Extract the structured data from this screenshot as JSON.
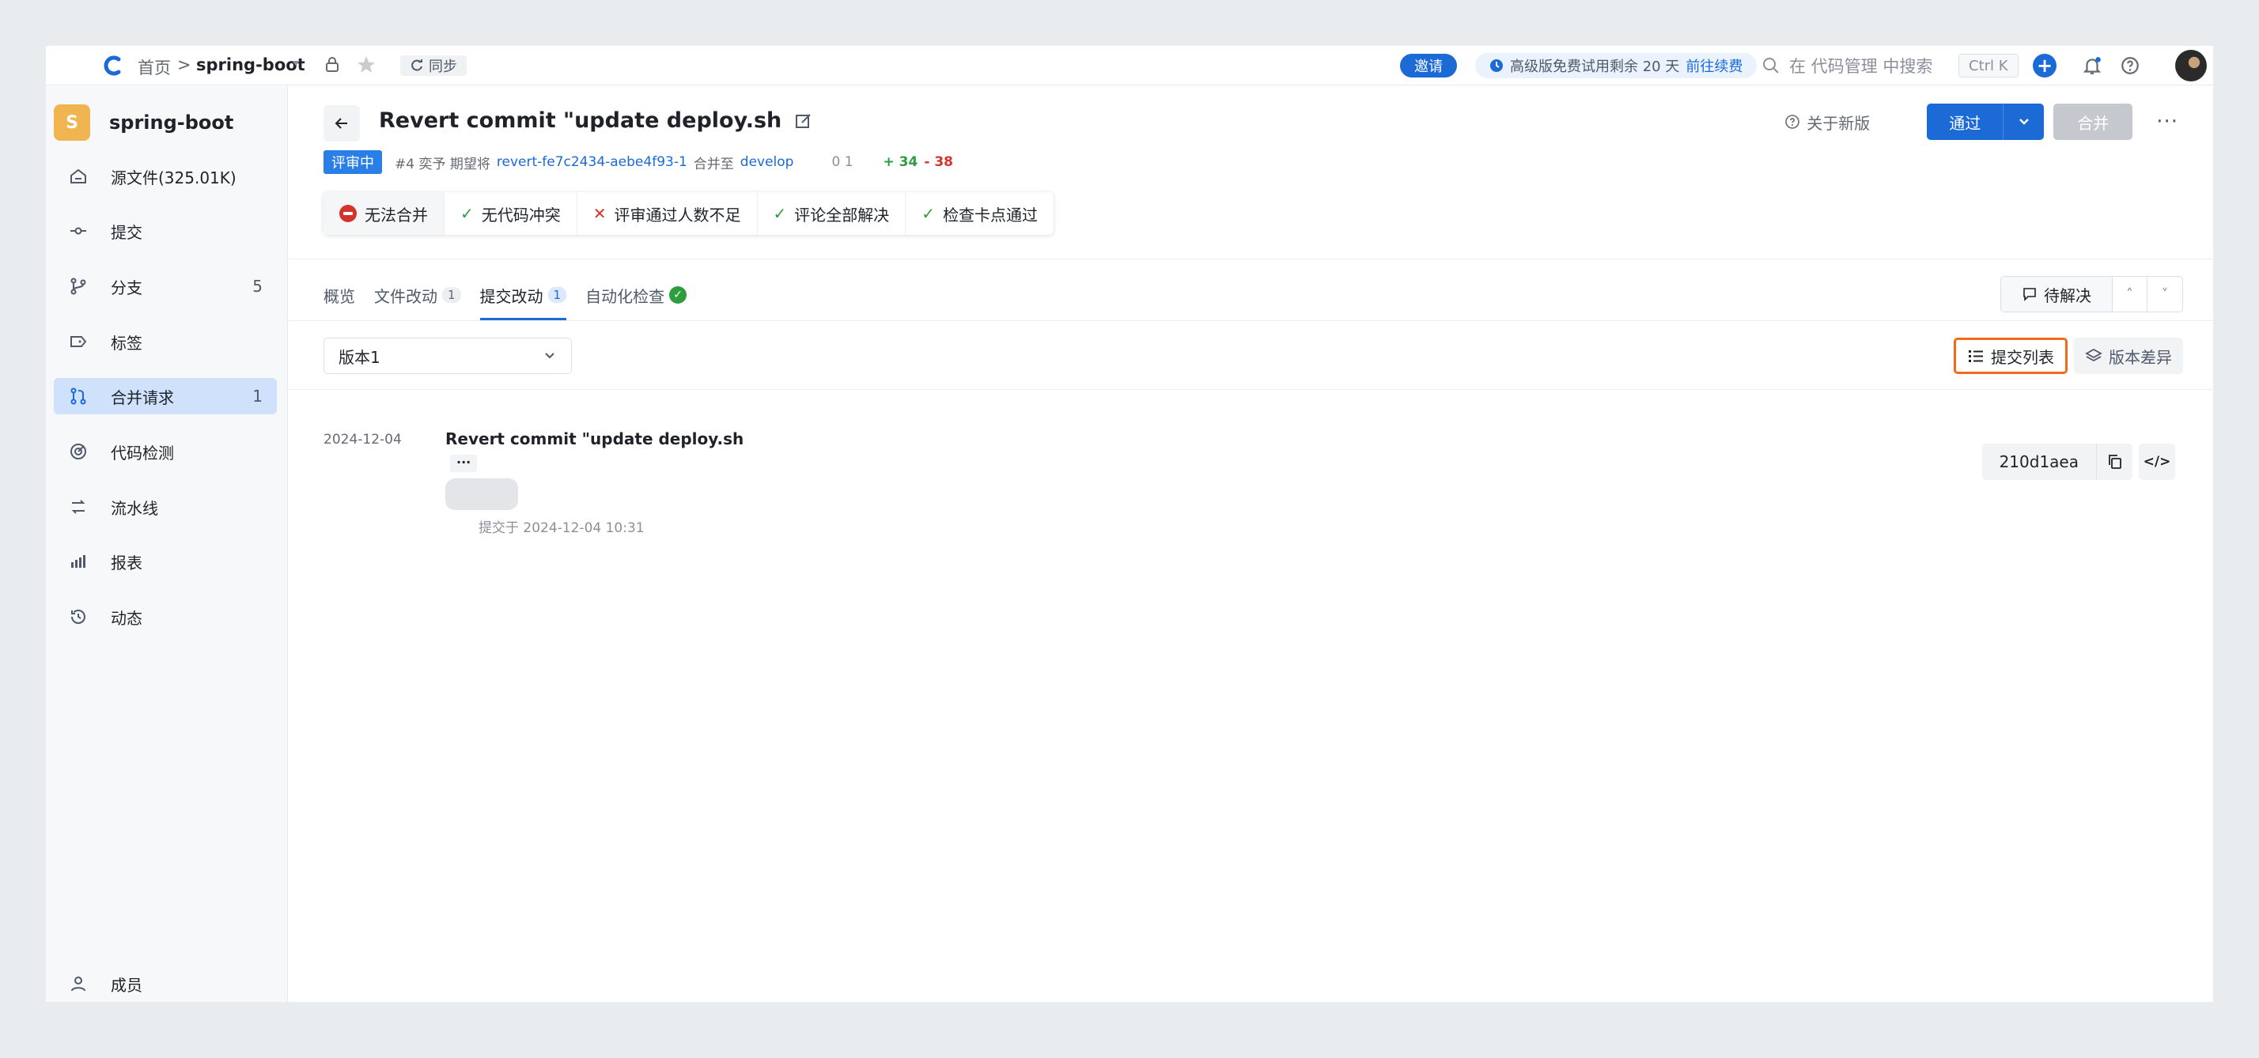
{
  "topbar": {
    "breadcrumb_home": "首页",
    "breadcrumb_sep": ">",
    "repo_name": "spring-boot",
    "sync_label": "同步",
    "invite_label": "邀请",
    "trial_text": "高级版免费试用剩余 20 天",
    "trial_link": "前往续费",
    "search_placeholder": "在 代码管理 中搜索",
    "shortcut": "Ctrl K",
    "plus": "+"
  },
  "sidebar": {
    "repo_badge": "S",
    "repo_name": "spring-boot",
    "items": [
      {
        "label": "源文件(325.01K)",
        "count": ""
      },
      {
        "label": "提交",
        "count": ""
      },
      {
        "label": "分支",
        "count": "5"
      },
      {
        "label": "标签",
        "count": ""
      },
      {
        "label": "合并请求",
        "count": "1"
      },
      {
        "label": "代码检测",
        "count": ""
      },
      {
        "label": "流水线",
        "count": ""
      },
      {
        "label": "报表",
        "count": ""
      },
      {
        "label": "动态",
        "count": ""
      }
    ],
    "members_label": "成员"
  },
  "mr": {
    "title": "Revert commit \"update deploy.sh",
    "status": "评审中",
    "meta_id": "#4 奕予 期望将",
    "source_branch": "revert-fe7c2434-aebe4f93-1",
    "merge_to": "合并至",
    "target_branch": "develop",
    "counts": "0 1",
    "additions": "+ 34",
    "deletions": "- 38"
  },
  "checks": [
    {
      "label": "无法合并",
      "state": "blocked"
    },
    {
      "label": "无代码冲突",
      "state": "ok"
    },
    {
      "label": "评审通过人数不足",
      "state": "fail"
    },
    {
      "label": "评论全部解决",
      "state": "ok"
    },
    {
      "label": "检查卡点通过",
      "state": "ok"
    }
  ],
  "actions": {
    "about": "关于新版",
    "approve": "通过",
    "merge": "合并",
    "more": "···"
  },
  "tabs": [
    {
      "label": "概览",
      "count": ""
    },
    {
      "label": "文件改动",
      "count": "1"
    },
    {
      "label": "提交改动",
      "count": "1"
    },
    {
      "label": "自动化检查",
      "count": ""
    }
  ],
  "pending": {
    "label": "待解决",
    "up": "˄",
    "down": "˅"
  },
  "version": {
    "selected": "版本1"
  },
  "view_toggle": {
    "commit_list": "提交列表",
    "version_diff": "版本差异"
  },
  "commit": {
    "date": "2024-12-04",
    "title": "Revert commit \"update deploy.sh",
    "ellipsis": "···",
    "time": "提交于 2024-12-04 10:31",
    "hash": "210d1aea",
    "code": "</>"
  },
  "colors": {
    "accent": "#1b6ad6",
    "highlight": "#f26b1d",
    "success": "#2e9d3e",
    "danger": "#d4342c"
  }
}
